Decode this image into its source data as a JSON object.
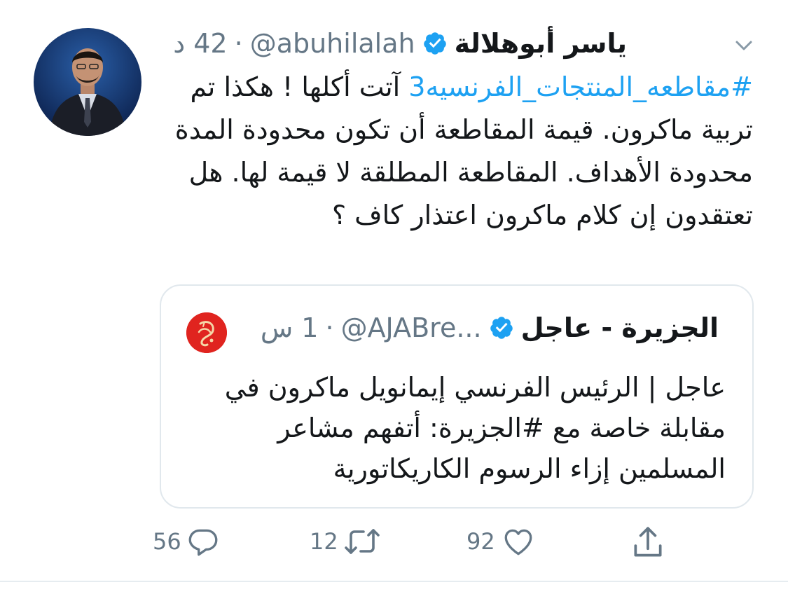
{
  "tweet": {
    "author_name": "ياسر أبوهلالة",
    "handle": "@abuhilalah",
    "separator": "·",
    "time": "42 د",
    "hashtag": "#مقاطعه_المنتجات_الفرنسيه3",
    "text_after_hashtag": " آتت أكلها ! هكذا تم تربية ماكرون. قيمة المقاطعة أن تكون محدودة المدة محدودة الأهداف. المقاطعة المطلقة لا قيمة لها. هل تعتقدون إن كلام ماكرون اعتذار كاف ؟"
  },
  "quoted_tweet": {
    "author_name": "الجزيرة - عاجل",
    "handle": "@AJABre...",
    "separator": "·",
    "time": "1 س",
    "text": "عاجل | الرئيس الفرنسي إيمانويل ماكرون في مقابلة خاصة مع #الجزيرة: أتفهم مشاعر المسلمين إزاء الرسوم الكاريكاتورية"
  },
  "actions": {
    "reply_count": "56",
    "retweet_count": "12",
    "like_count": "92"
  },
  "icons": {
    "verified": "verified-badge-icon",
    "caret": "chevron-down-icon",
    "reply": "reply-icon",
    "retweet": "retweet-icon",
    "like": "heart-icon",
    "share": "share-icon"
  },
  "colors": {
    "accent": "#1da1f2",
    "muted": "#657786",
    "text": "#14171a",
    "border": "#e1e8ed",
    "aljazeera_red": "#e0241f"
  }
}
